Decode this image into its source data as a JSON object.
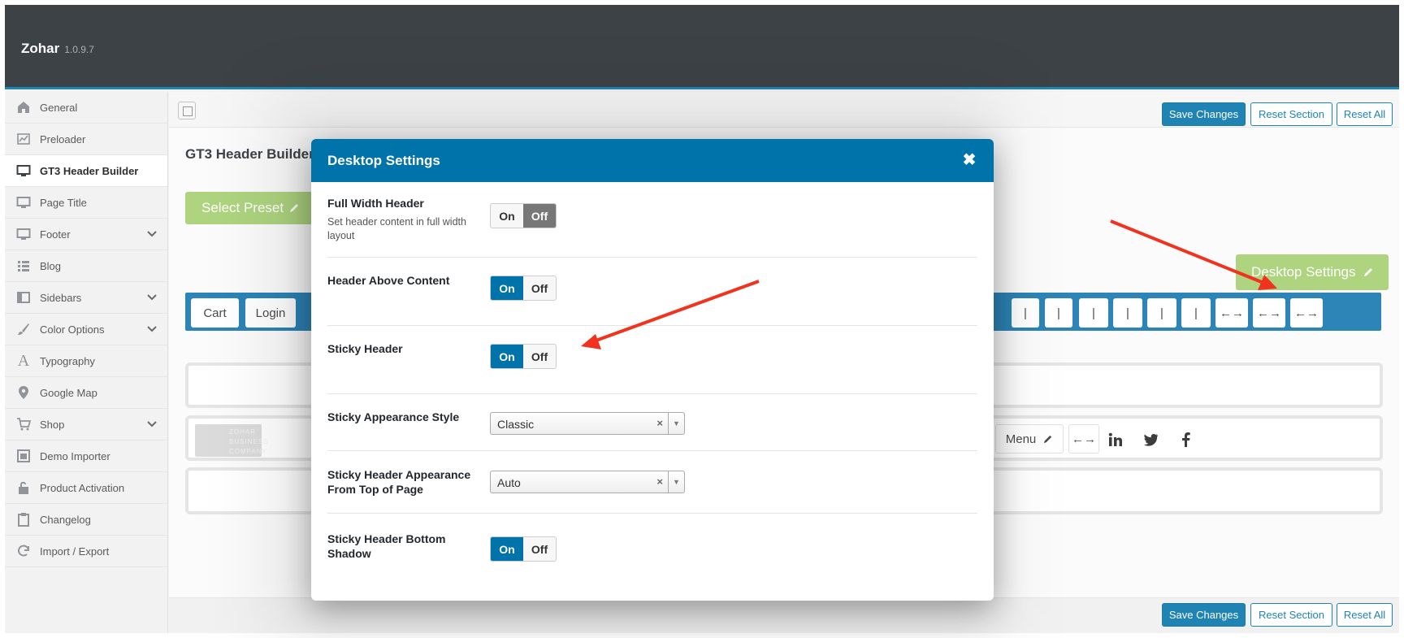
{
  "app": {
    "name": "Zohar",
    "version": "1.0.9.7"
  },
  "sidebar": {
    "items": [
      {
        "label": "General",
        "icon": "home-icon"
      },
      {
        "label": "Preloader",
        "icon": "chart-icon"
      },
      {
        "label": "GT3 Header Builder",
        "icon": "desktop-icon",
        "active": true
      },
      {
        "label": "Page Title",
        "icon": "desktop-icon"
      },
      {
        "label": "Footer",
        "icon": "desktop-icon",
        "expandable": true
      },
      {
        "label": "Blog",
        "icon": "list-icon"
      },
      {
        "label": "Sidebars",
        "icon": "columns-icon",
        "expandable": true
      },
      {
        "label": "Color Options",
        "icon": "brush-icon",
        "expandable": true
      },
      {
        "label": "Typography",
        "icon": "font-icon"
      },
      {
        "label": "Google Map",
        "icon": "map-pin-icon"
      },
      {
        "label": "Shop",
        "icon": "cart-icon",
        "expandable": true
      },
      {
        "label": "Demo Importer",
        "icon": "window-icon"
      },
      {
        "label": "Product Activation",
        "icon": "unlock-icon"
      },
      {
        "label": "Changelog",
        "icon": "clipboard-icon"
      },
      {
        "label": "Import / Export",
        "icon": "refresh-icon"
      }
    ]
  },
  "toolbar": {
    "save_label": "Save Changes",
    "reset_section_label": "Reset Section",
    "reset_all_label": "Reset All"
  },
  "builder": {
    "heading": "GT3 Header Builder",
    "select_preset_label": "Select Preset",
    "desktop_settings_label": "Desktop Settings",
    "elements_left": [
      "Cart",
      "Login"
    ],
    "elements_right": [
      "|",
      "|",
      "|",
      "|",
      "|",
      "|",
      "←→",
      "←→",
      "←→"
    ],
    "row_menu_label": "Menu",
    "row_spacer_label": "←→",
    "logo_text": "ZOHAR BUSINESS COMPANY"
  },
  "modal": {
    "title": "Desktop Settings",
    "close_glyph": "✖",
    "settings": [
      {
        "label": "Full Width Header",
        "desc": "Set header content in full width layout",
        "type": "toggle",
        "on": "On",
        "off": "Off",
        "value": "off"
      },
      {
        "label": "Header Above Content",
        "type": "toggle",
        "on": "On",
        "off": "Off",
        "value": "on"
      },
      {
        "label": "Sticky Header",
        "type": "toggle",
        "on": "On",
        "off": "Off",
        "value": "on"
      },
      {
        "label": "Sticky Appearance Style",
        "type": "select",
        "value": "Classic",
        "clear": "×"
      },
      {
        "label": "Sticky Header Appearance From Top of Page",
        "type": "select",
        "value": "Auto",
        "clear": "×"
      },
      {
        "label": "Sticky Header Bottom Shadow",
        "type": "toggle",
        "on": "On",
        "off": "Off",
        "value": "on"
      }
    ]
  },
  "colors": {
    "accent": "#0073aa",
    "header_bg": "#23282d",
    "preset_green": "#a3cf6e",
    "arrow_red": "#f0321e"
  }
}
